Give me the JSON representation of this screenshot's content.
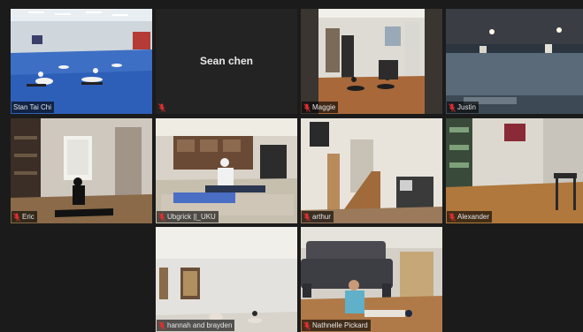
{
  "participants": [
    {
      "name": "Stan Tai Chi",
      "muted": true,
      "active": true
    },
    {
      "name": "Sean chen",
      "muted": true,
      "active": false,
      "video_off": true
    },
    {
      "name": "Maggie",
      "muted": true,
      "active": false
    },
    {
      "name": "Justin",
      "muted": true,
      "active": false
    },
    {
      "name": "Eric",
      "muted": true,
      "active": false
    },
    {
      "name": "Ubgrick ||_UKU",
      "muted": true,
      "active": false
    },
    {
      "name": "arthur",
      "muted": true,
      "active": false
    },
    {
      "name": "Alexander",
      "muted": true,
      "active": false
    },
    {
      "name": "hannah and brayden",
      "muted": true,
      "active": false
    },
    {
      "name": "Nathnelle Pickard",
      "muted": true,
      "active": false
    }
  ],
  "icons": {
    "muted": "mic-muted-icon"
  },
  "colors": {
    "active_border": "#c7d34a",
    "muted_icon": "#e03030",
    "background": "#1b1b1b"
  }
}
